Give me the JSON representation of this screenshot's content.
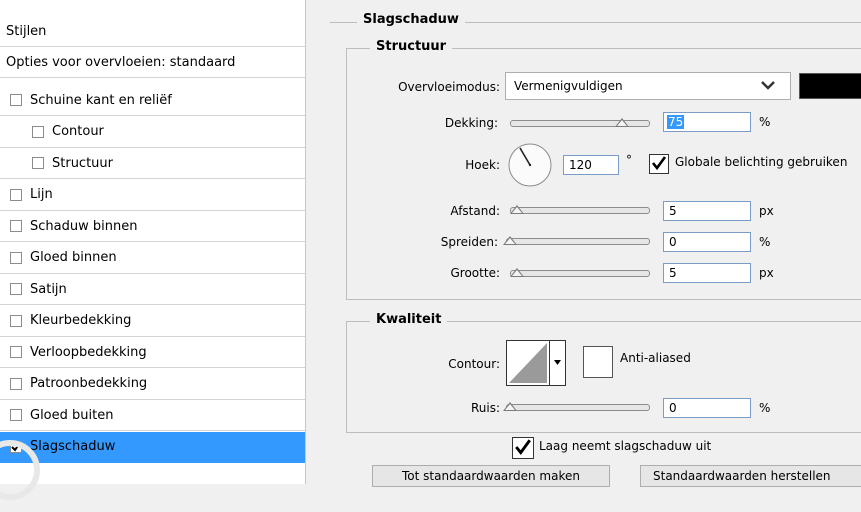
{
  "styles_panel": {
    "header": "Stijlen",
    "blend_options": "Opties voor overvloeien: standaard",
    "items": [
      {
        "label": "Schuine kant en reliëf",
        "checked": false,
        "indent": 0
      },
      {
        "label": "Contour",
        "checked": false,
        "indent": 1
      },
      {
        "label": "Structuur",
        "checked": false,
        "indent": 1
      },
      {
        "label": "Lijn",
        "checked": false,
        "indent": 0
      },
      {
        "label": "Schaduw binnen",
        "checked": false,
        "indent": 0
      },
      {
        "label": "Gloed binnen",
        "checked": false,
        "indent": 0
      },
      {
        "label": "Satijn",
        "checked": false,
        "indent": 0
      },
      {
        "label": "Kleurbedekking",
        "checked": false,
        "indent": 0
      },
      {
        "label": "Verloopbedekking",
        "checked": false,
        "indent": 0
      },
      {
        "label": "Patroonbedekking",
        "checked": false,
        "indent": 0
      },
      {
        "label": "Gloed buiten",
        "checked": false,
        "indent": 0
      },
      {
        "label": "Slagschaduw",
        "checked": true,
        "indent": 0,
        "selected": true
      }
    ]
  },
  "drop_shadow": {
    "title": "Slagschaduw",
    "structure": {
      "title": "Structuur",
      "blend_mode_label": "Overvloeimodus:",
      "blend_mode_value": "Vermenigvuldigen",
      "shadow_color": "#000000",
      "opacity_label": "Dekking:",
      "opacity_value": "75",
      "opacity_unit": "%",
      "angle_label": "Hoek:",
      "angle_value": "120",
      "angle_unit": "°",
      "global_light_label": "Globale belichting gebruiken",
      "global_light_checked": true,
      "distance_label": "Afstand:",
      "distance_value": "5",
      "distance_unit": "px",
      "spread_label": "Spreiden:",
      "spread_value": "0",
      "spread_unit": "%",
      "size_label": "Grootte:",
      "size_value": "5",
      "size_unit": "px"
    },
    "quality": {
      "title": "Kwaliteit",
      "contour_label": "Contour:",
      "anti_aliased_label": "Anti-aliased",
      "anti_aliased_checked": false,
      "noise_label": "Ruis:",
      "noise_value": "0",
      "noise_unit": "%"
    },
    "knockout_label": "Laag neemt slagschaduw uit",
    "knockout_checked": true,
    "make_default_label": "Tot standaardwaarden maken",
    "reset_default_label": "Standaardwaarden herstellen"
  },
  "colors": {
    "selection": "#3399ff",
    "panel_bg": "#f0f0f0"
  }
}
